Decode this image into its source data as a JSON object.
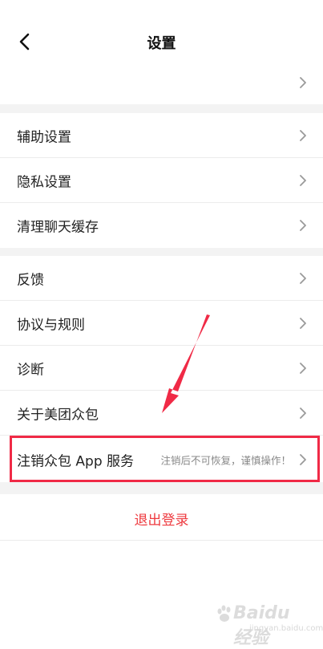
{
  "header": {
    "title": "设置",
    "back_icon": "chevron-left-icon"
  },
  "profile": {
    "avatar_icon": "avatar-image",
    "chevron_icon": "chevron-right-icon"
  },
  "groups": [
    {
      "items": [
        {
          "label": "辅助设置"
        },
        {
          "label": "隐私设置"
        },
        {
          "label": "清理聊天缓存"
        }
      ]
    },
    {
      "items": [
        {
          "label": "反馈"
        },
        {
          "label": "协议与规则"
        },
        {
          "label": "诊断"
        },
        {
          "label": "关于美团众包"
        },
        {
          "label": "注销众包 App 服务",
          "note": "注销后不可恢复，谨慎操作！"
        }
      ]
    }
  ],
  "logout": {
    "label": "退出登录"
  },
  "annotation": {
    "highlight_color": "#f02a46",
    "arrow_color": "#f02a46"
  },
  "colors": {
    "logout_text": "#ee3a3f",
    "section_gap": "#f3f3f3",
    "divider": "#ececec"
  },
  "watermark": {
    "brand": "Baidu 经验",
    "sub": "jingyan.baidu.com"
  }
}
